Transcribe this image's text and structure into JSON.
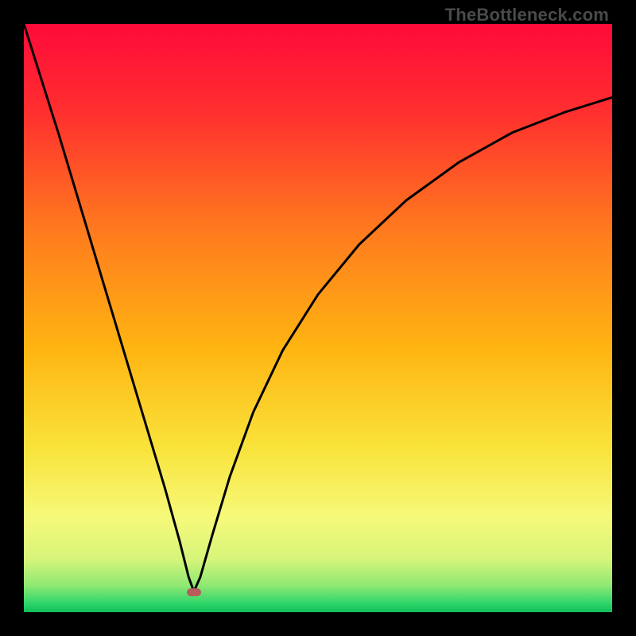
{
  "watermark": "TheBottleneck.com",
  "gradient_stops": [
    {
      "offset": 0.0,
      "color": "#ff0a3a"
    },
    {
      "offset": 0.15,
      "color": "#ff2f2f"
    },
    {
      "offset": 0.35,
      "color": "#ff7a1e"
    },
    {
      "offset": 0.55,
      "color": "#ffb412"
    },
    {
      "offset": 0.72,
      "color": "#f9e33a"
    },
    {
      "offset": 0.84,
      "color": "#f6f97a"
    },
    {
      "offset": 0.91,
      "color": "#d6f57a"
    },
    {
      "offset": 0.955,
      "color": "#8ee873"
    },
    {
      "offset": 0.985,
      "color": "#2fd66b"
    },
    {
      "offset": 1.0,
      "color": "#0fbf57"
    }
  ],
  "marker": {
    "x_frac": 0.289,
    "y_frac": 0.966,
    "color": "#b85b5b"
  },
  "chart_data": {
    "type": "line",
    "title": "",
    "xlabel": "",
    "ylabel": "",
    "series": [
      {
        "name": "curve",
        "x_range": [
          0,
          1
        ],
        "y_is_fraction_from_top": true,
        "points": [
          {
            "x": 0.0,
            "y": 0.0
          },
          {
            "x": 0.03,
            "y": 0.095
          },
          {
            "x": 0.06,
            "y": 0.19
          },
          {
            "x": 0.09,
            "y": 0.29
          },
          {
            "x": 0.12,
            "y": 0.39
          },
          {
            "x": 0.15,
            "y": 0.49
          },
          {
            "x": 0.18,
            "y": 0.59
          },
          {
            "x": 0.21,
            "y": 0.69
          },
          {
            "x": 0.24,
            "y": 0.79
          },
          {
            "x": 0.265,
            "y": 0.88
          },
          {
            "x": 0.28,
            "y": 0.94
          },
          {
            "x": 0.289,
            "y": 0.965
          },
          {
            "x": 0.3,
            "y": 0.94
          },
          {
            "x": 0.32,
            "y": 0.87
          },
          {
            "x": 0.35,
            "y": 0.77
          },
          {
            "x": 0.39,
            "y": 0.66
          },
          {
            "x": 0.44,
            "y": 0.555
          },
          {
            "x": 0.5,
            "y": 0.46
          },
          {
            "x": 0.57,
            "y": 0.375
          },
          {
            "x": 0.65,
            "y": 0.3
          },
          {
            "x": 0.74,
            "y": 0.235
          },
          {
            "x": 0.83,
            "y": 0.185
          },
          {
            "x": 0.92,
            "y": 0.15
          },
          {
            "x": 1.0,
            "y": 0.125
          }
        ]
      }
    ],
    "annotations": [
      {
        "type": "marker",
        "x": 0.289,
        "y": 0.965
      }
    ]
  }
}
